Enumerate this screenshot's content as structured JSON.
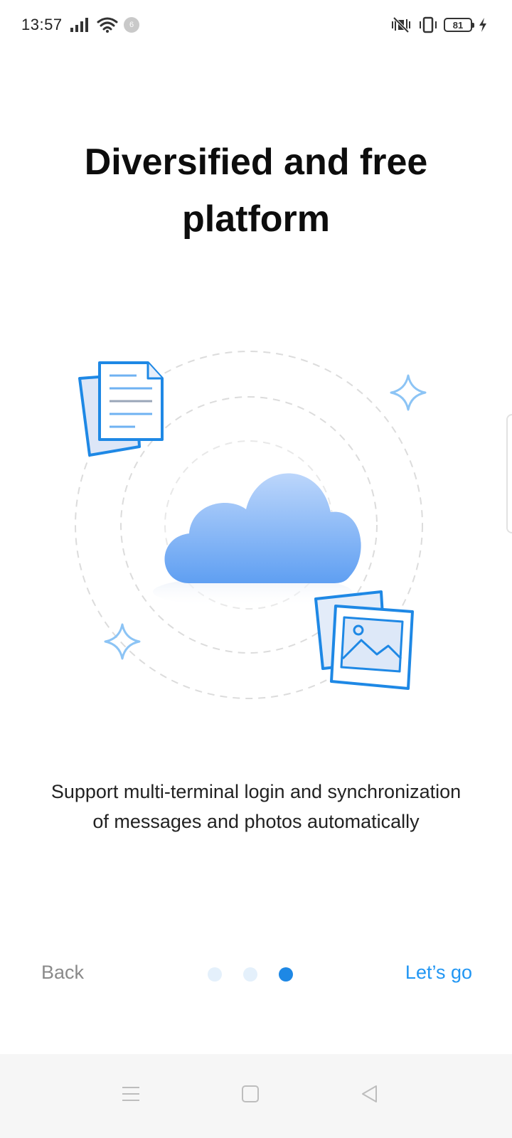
{
  "status_bar": {
    "time": "13:57",
    "notification_count": "6",
    "battery_level": "81"
  },
  "onboarding": {
    "title": "Diversified and free platform",
    "description": "Support multi-terminal login and synchronization of messages and photos automatically",
    "back_label": "Back",
    "next_label": "Let’s go",
    "page_index": 3,
    "page_count": 3
  },
  "icons": [
    "signal-icon",
    "wifi-icon",
    "vibrate-icon",
    "battery-icon",
    "charging-icon",
    "document-icon",
    "cloud-icon",
    "photo-icon",
    "sparkle-icon",
    "menu-icon",
    "home-icon",
    "back-icon"
  ],
  "colors": {
    "accent": "#2196f3",
    "active_dot": "#1e88e5",
    "inactive_dot": "#e4f0fb",
    "back_text": "#8a8a8a"
  }
}
